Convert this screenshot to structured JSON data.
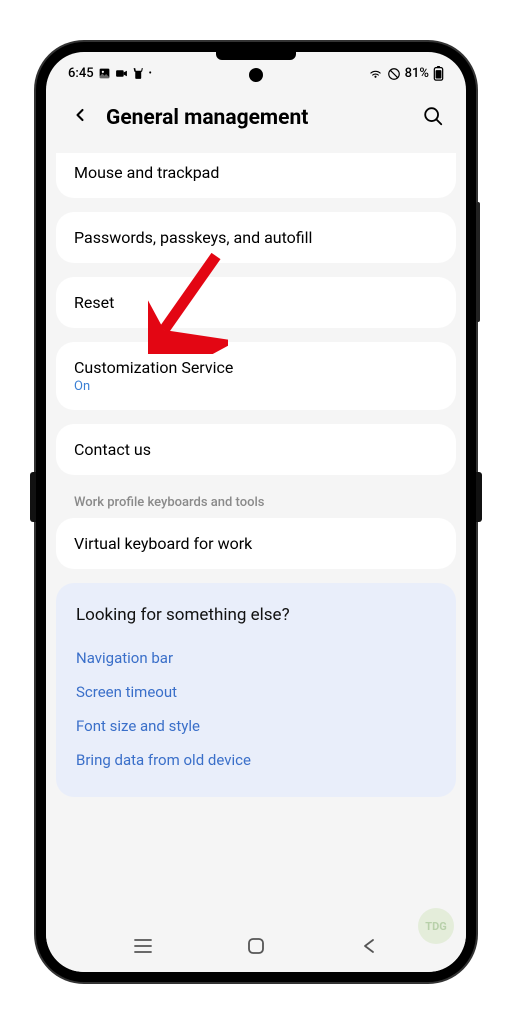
{
  "status": {
    "time": "6:45",
    "battery": "81%"
  },
  "header": {
    "title": "General management"
  },
  "items": {
    "mouse": "Mouse and trackpad",
    "passwords": "Passwords, passkeys, and autofill",
    "reset": "Reset",
    "customization": "Customization Service",
    "customization_status": "On",
    "contact": "Contact us",
    "work_section": "Work profile keyboards and tools",
    "virtual_keyboard": "Virtual keyboard for work"
  },
  "suggestions": {
    "title": "Looking for something else?",
    "links": [
      "Navigation bar",
      "Screen timeout",
      "Font size and style",
      "Bring data from old device"
    ]
  },
  "watermark": "TDG"
}
